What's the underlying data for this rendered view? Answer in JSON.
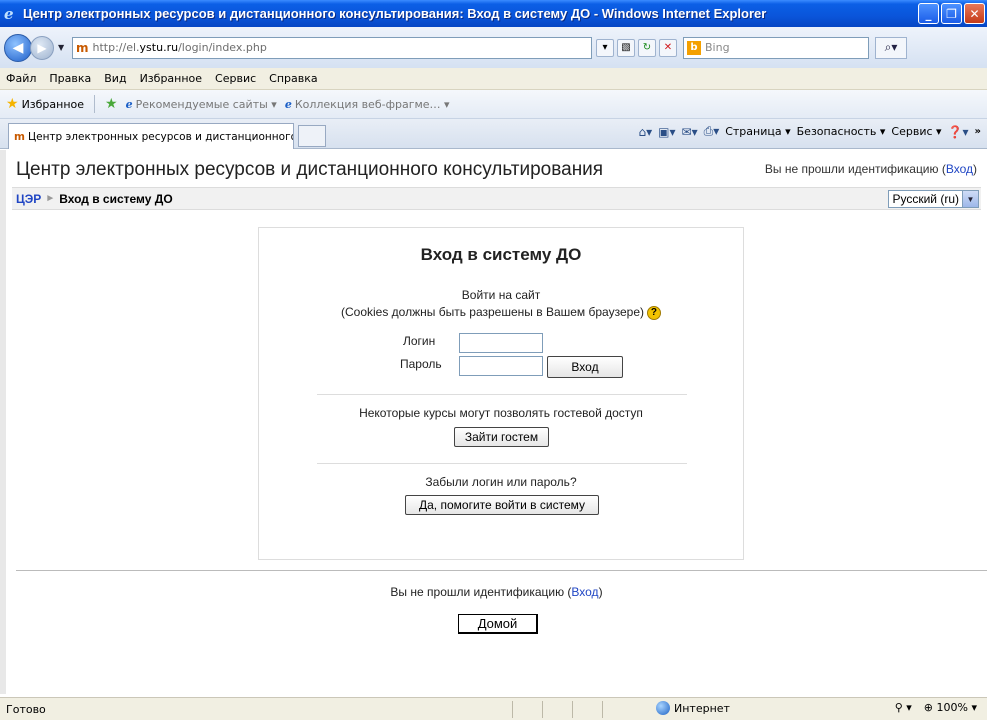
{
  "window": {
    "title": "Центр электронных ресурсов и дистанционного консультирования: Вход в систему ДО - Windows Internet Explorer",
    "minimize": "_",
    "maximize": "❐",
    "close": "✕"
  },
  "address": {
    "url_prefix": "http://el.",
    "url_host": "ystu.ru",
    "url_path": "/login/index.php",
    "search_placeholder": "Bing"
  },
  "menu": [
    "Файл",
    "Правка",
    "Вид",
    "Избранное",
    "Сервис",
    "Справка"
  ],
  "favorites_bar": {
    "favorites": "Избранное",
    "suggested": "Рекомендуемые сайты ▾",
    "gallery": "Коллекция веб-фрагме… ▾"
  },
  "tab": {
    "title": "Центр электронных ресурсов и дистанционного к…"
  },
  "command_bar": {
    "page": "Страница",
    "safety": "Безопасность",
    "tools": "Сервис"
  },
  "page": {
    "site_title": "Центр электронных ресурсов и дистанционного консультирования",
    "login_status_text": "Вы не прошли идентификацию (",
    "login_link": "Вход",
    "login_status_close": ")",
    "breadcrumb_home": "ЦЭР",
    "breadcrumb_sep": "►",
    "breadcrumb_current": "Вход в систему ДО",
    "language": "Русский (ru)"
  },
  "login": {
    "heading": "Вход в систему ДО",
    "intro_line1": "Войти на сайт",
    "intro_line2": "(Cookies должны быть разрешены в Вашем браузере)",
    "help_glyph": "?",
    "username_label": "Логин",
    "password_label": "Пароль",
    "username_value": "",
    "password_value": "",
    "login_button": "Вход",
    "guest_text": "Некоторые курсы могут позволять гостевой доступ",
    "guest_button": "Зайти гостем",
    "forgot_text": "Забыли логин или пароль?",
    "forgot_button": "Да, помогите войти в систему"
  },
  "footer": {
    "status_text": "Вы не прошли идентификацию (",
    "login_link": "Вход",
    "status_close": ")",
    "home_button": "Домой"
  },
  "statusbar": {
    "state": "Готово",
    "zone": "Интернет",
    "zoom": "100%"
  }
}
